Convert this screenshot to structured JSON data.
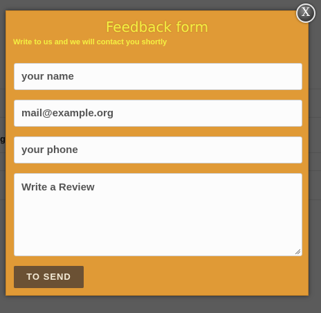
{
  "modal": {
    "title": "Feedback form",
    "subtitle": "Write to us and we will contact you shortly",
    "close_label": "X"
  },
  "form": {
    "name_placeholder": "your name",
    "email_placeholder": "mail@example.org",
    "phone_placeholder": "your phone",
    "review_placeholder": "Write a Review",
    "submit_label": "TO SEND"
  },
  "background": {
    "fragment": "g"
  },
  "colors": {
    "modal_bg": "#e09a36",
    "title": "#f5f042",
    "button_bg": "#6b5134",
    "overlay": "#5f5f5f"
  }
}
